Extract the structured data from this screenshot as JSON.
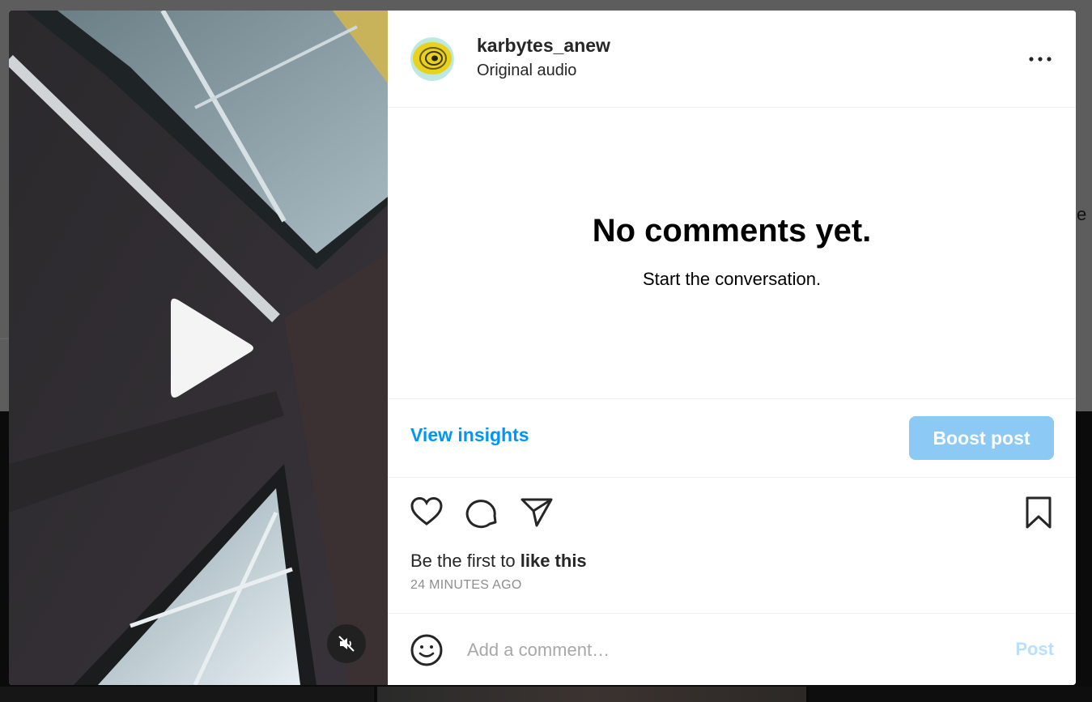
{
  "post": {
    "username": "karbytes_anew",
    "audio": "Original audio",
    "likes_prefix": "Be the first to",
    "likes_cta": "like this",
    "timestamp": "24 MINUTES AGO"
  },
  "comments": {
    "empty_title": "No comments yet.",
    "empty_subtitle": "Start the conversation."
  },
  "insights": {
    "view_label": "View insights",
    "boost_label": "Boost post"
  },
  "composer": {
    "placeholder": "Add a comment…",
    "post_label": "Post"
  },
  "backdrop": {
    "peek_letter": "e"
  },
  "icons": {
    "more": "more-options-icon",
    "like": "heart-icon",
    "comment": "comment-bubble-icon",
    "share": "paper-plane-icon",
    "save": "bookmark-icon",
    "emoji": "smiley-icon",
    "play": "play-icon",
    "mute": "muted-speaker-icon"
  },
  "colors": {
    "accent": "#0095f6",
    "boost_button": "#8cc9f5",
    "post_disabled": "#b9dffc",
    "muted_text": "#8e8e8e"
  }
}
